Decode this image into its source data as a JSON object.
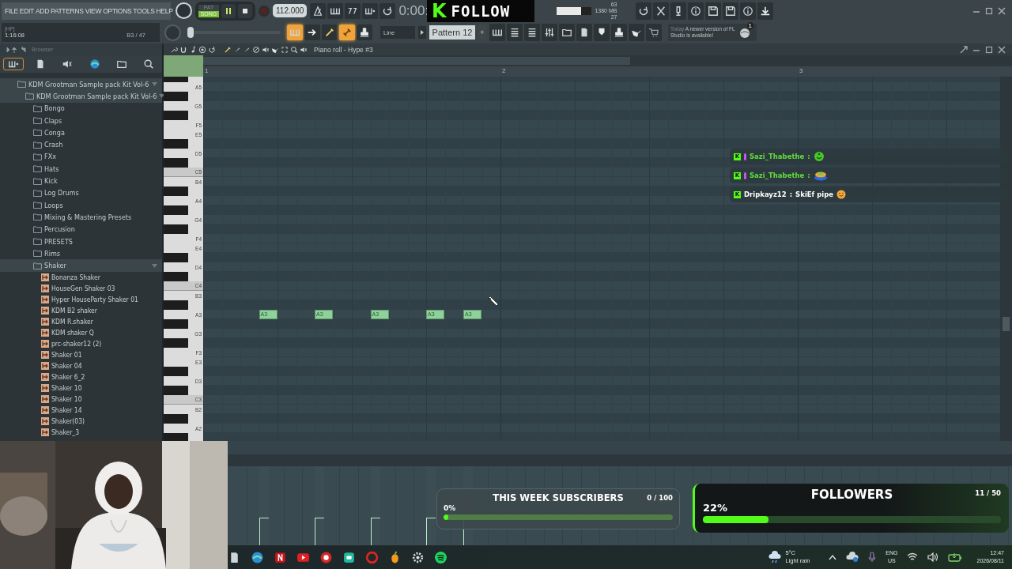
{
  "menu": [
    "FILE",
    "EDIT",
    "ADD",
    "PATTERNS",
    "VIEW",
    "OPTIONS",
    "TOOLS",
    "HELP"
  ],
  "transport": {
    "modes": [
      {
        "label": "PAT",
        "selected": false
      },
      {
        "label": "SONG",
        "selected": true
      }
    ],
    "playing": true,
    "recording": false,
    "tempo": "112.000",
    "time": "0:00:"
  },
  "hint": {
    "title": "[HP]",
    "time": "1:16:08",
    "position": "B3 / 47"
  },
  "cpu": {
    "value": "63",
    "memory": "1380 MB",
    "polyphony": "27",
    "level": 0.7
  },
  "pitch": {
    "level": 0
  },
  "toggles": [
    {
      "on": true
    },
    {
      "on": false
    },
    {
      "on": false
    },
    {
      "on": true
    },
    {
      "on": false
    }
  ],
  "snap": "Line",
  "pattern": "Pattern 12",
  "pattern_add": "+",
  "news": {
    "date": "Today",
    "text": "A newer version of FL Studio is available!",
    "badge": "1"
  },
  "follow_banner": {
    "logo": "K",
    "text": "FOLLOW"
  },
  "browser": {
    "title": "Browser",
    "tabs": [
      {
        "selected": true
      },
      {
        "selected": false
      },
      {
        "selected": false
      },
      {
        "selected": false
      },
      {
        "selected": false
      },
      {
        "selected": false
      }
    ],
    "tree": [
      {
        "label": "KDM Grootman Sample pack Kit Vol-6",
        "kind": "folder",
        "expanded": true,
        "children": [
          {
            "label": "KDM Grootman Sample pack Kit Vol-6",
            "kind": "folder",
            "expanded": true,
            "children": [
              {
                "label": "Bongo",
                "kind": "folder",
                "expanded": false
              },
              {
                "label": "Claps",
                "kind": "folder",
                "expanded": false
              },
              {
                "label": "Conga",
                "kind": "folder",
                "expanded": false
              },
              {
                "label": "Crash",
                "kind": "folder",
                "expanded": false
              },
              {
                "label": "FXx",
                "kind": "folder",
                "expanded": false
              },
              {
                "label": "Hats",
                "kind": "folder",
                "expanded": false
              },
              {
                "label": "Kick",
                "kind": "folder",
                "expanded": false
              },
              {
                "label": "Log Drums",
                "kind": "folder",
                "expanded": false
              },
              {
                "label": "Loops",
                "kind": "folder",
                "expanded": false
              },
              {
                "label": "Mixing & Mastering Presets",
                "kind": "folder",
                "expanded": false
              },
              {
                "label": "Percusion",
                "kind": "folder",
                "expanded": false
              },
              {
                "label": "PRESETS",
                "kind": "folder",
                "expanded": false
              },
              {
                "label": "Rims",
                "kind": "folder",
                "expanded": false
              },
              {
                "label": "Shaker",
                "kind": "folder",
                "expanded": true,
                "children": [
                  {
                    "label": "Bonanza Shaker",
                    "kind": "file"
                  },
                  {
                    "label": "HouseGen Shaker 03",
                    "kind": "file"
                  },
                  {
                    "label": "Hyper HouseParty Shaker 01",
                    "kind": "file"
                  },
                  {
                    "label": "KDM B2 shaker",
                    "kind": "file"
                  },
                  {
                    "label": "KDM R.shaker",
                    "kind": "file"
                  },
                  {
                    "label": "KDM shaker Q",
                    "kind": "file"
                  },
                  {
                    "label": "prc-shaker12 (2)",
                    "kind": "file"
                  },
                  {
                    "label": "Shaker 01",
                    "kind": "file"
                  },
                  {
                    "label": "Shaker 04",
                    "kind": "file"
                  },
                  {
                    "label": "Shaker 6_2",
                    "kind": "file"
                  },
                  {
                    "label": "Shaker 10",
                    "kind": "file"
                  },
                  {
                    "label": "Shaker 10",
                    "kind": "file"
                  },
                  {
                    "label": "Shaker 14",
                    "kind": "file"
                  },
                  {
                    "label": "Shaker(03)",
                    "kind": "file"
                  },
                  {
                    "label": "Shaker_3",
                    "kind": "file"
                  }
                ]
              }
            ]
          }
        ]
      }
    ]
  },
  "piano_roll": {
    "title": "Piano roll - Hype #3",
    "bars": [
      "1",
      "2",
      "3"
    ],
    "keys": [
      "A5",
      "G5",
      "F5",
      "E5",
      "D5",
      "C5",
      "B4",
      "A4",
      "G4",
      "F4",
      "E4",
      "D4",
      "C4",
      "B3",
      "A3",
      "G3",
      "F3",
      "E3",
      "D3",
      "C3",
      "B2",
      "A2"
    ],
    "steps": [
      {
        "kind": "rest"
      },
      {
        "kind": "rest"
      },
      {
        "kind": "rest"
      },
      {
        "kind": "note",
        "label": "A3",
        "level": 0.35
      },
      {
        "kind": "rest"
      },
      {
        "kind": "rest"
      },
      {
        "kind": "note",
        "label": "A3",
        "level": 0.35
      },
      {
        "kind": "rest"
      },
      {
        "kind": "rest"
      },
      {
        "kind": "note",
        "label": "A3",
        "level": 0.35
      },
      {
        "kind": "rest"
      },
      {
        "kind": "rest"
      },
      {
        "kind": "note",
        "label": "A3",
        "level": 0.35
      },
      {
        "kind": "rest"
      },
      {
        "kind": "note",
        "label": "A3",
        "level": 0.35
      },
      {
        "kind": "rest"
      }
    ]
  },
  "chat": [
    {
      "kind": "emote",
      "logo": "K",
      "badge": true,
      "user": "Sazi_Thabethe",
      "color": "#5fe03c",
      "separator": ":"
    },
    {
      "kind": "emote",
      "logo": "K",
      "badge": true,
      "user": "Sazi_Thabethe",
      "color": "#5fe03c",
      "separator": ":"
    },
    {
      "kind": "message",
      "logo": "K",
      "badge": false,
      "user": "Dripkayz12",
      "color": "#ffffff",
      "separator": ":",
      "text": "SkiEf pipe"
    }
  ],
  "goals": [
    {
      "kind": "subscribers",
      "title": "THIS WEEK SUBSCRIBERS",
      "count": "0 / 100",
      "percent": "0%",
      "level": 0
    },
    {
      "kind": "followers",
      "title": "FOLLOWERS",
      "count": "11 / 50",
      "percent": "22%",
      "level": 0.22
    }
  ],
  "taskbar": {
    "weather": {
      "temp": "5°C",
      "text": "Light rain"
    },
    "language": [
      "ENG",
      "US"
    ],
    "time": "12:47",
    "date": "2026/08/11"
  }
}
